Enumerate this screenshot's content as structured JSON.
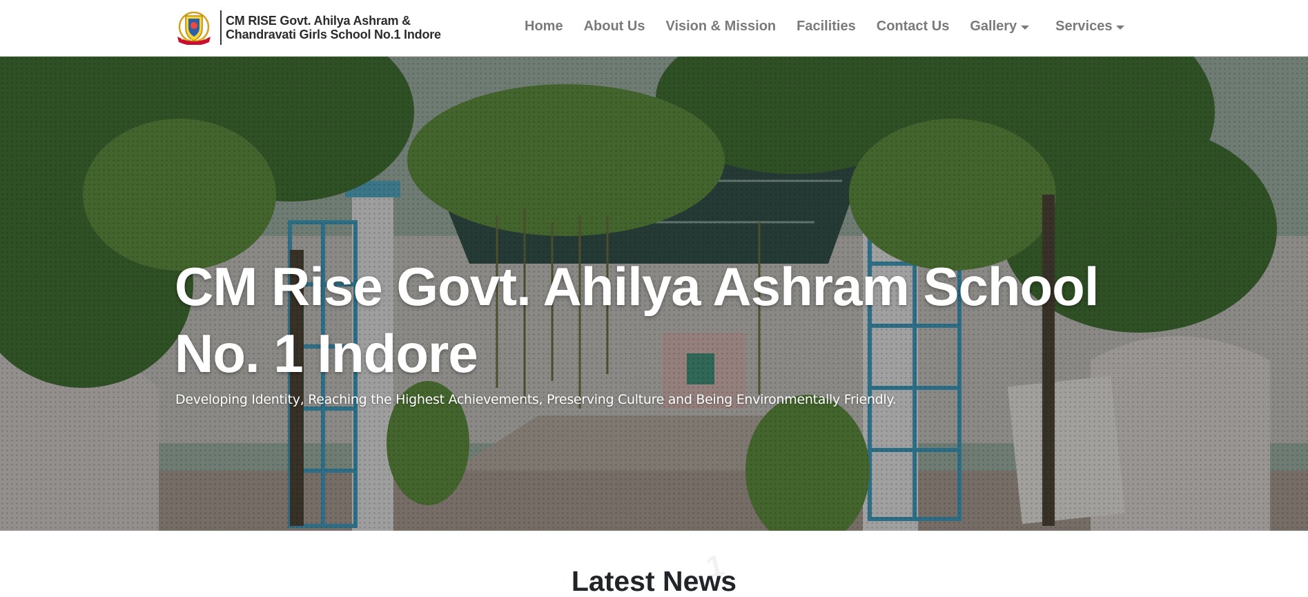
{
  "navbar": {
    "brand_line1": "CM RISE Govt. Ahilya Ashram &",
    "brand_line2": "Chandravati Girls School No.1 Indore",
    "links": [
      {
        "label": "Home"
      },
      {
        "label": "About Us"
      },
      {
        "label": "Vision & Mission"
      },
      {
        "label": "Facilities"
      },
      {
        "label": "Contact Us"
      },
      {
        "label": "Gallery"
      },
      {
        "label": "Services"
      }
    ]
  },
  "hero": {
    "title": "CM Rise Govt. Ahilya Ashram School No. 1 Indore",
    "subtitle": "Developing Identity, Reaching the Highest Achievements, Preserving Culture and Being Environmentally Friendly."
  },
  "news": {
    "heading": "Latest News"
  },
  "colors": {
    "nav_text": "#7a7a7a",
    "brand_text": "#2b2b2b",
    "hero_text": "#ffffff",
    "heading_text": "#212529"
  },
  "icons": {
    "logo": "school-crest-logo",
    "dropdown": "caret-down-icon"
  }
}
